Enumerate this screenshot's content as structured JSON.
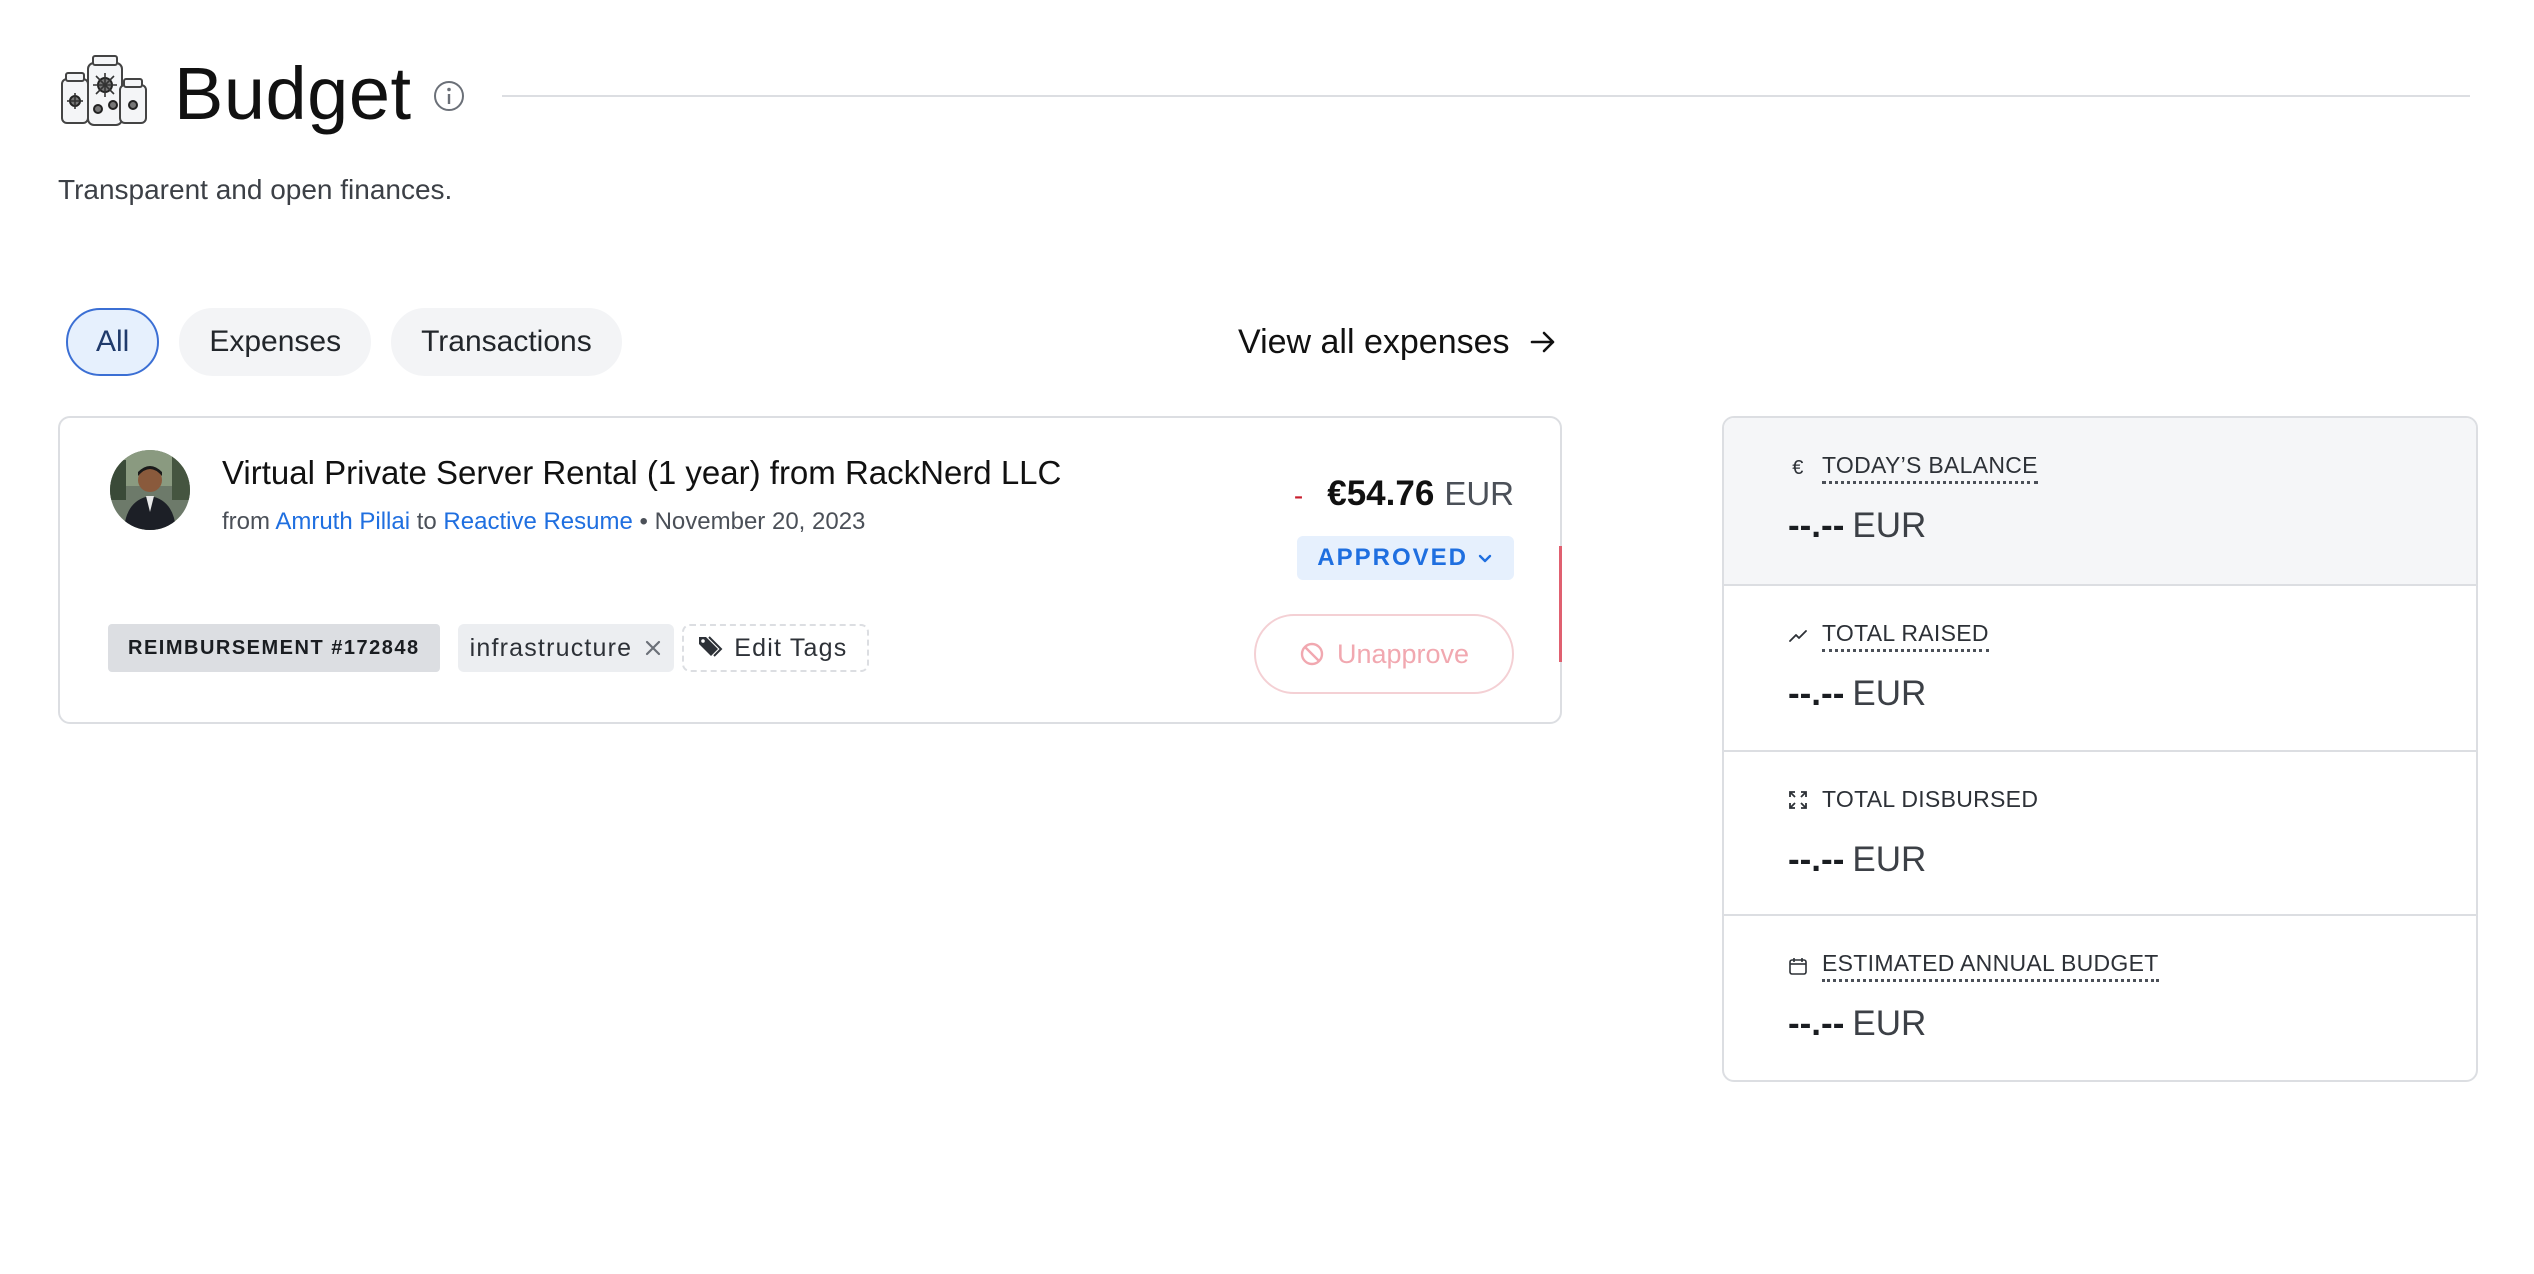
{
  "header": {
    "title": "Budget",
    "subtitle": "Transparent and open finances.",
    "logo_icon": "donation-jars-icon",
    "info_icon": "info-icon"
  },
  "tabs": [
    {
      "label": "All",
      "active": true
    },
    {
      "label": "Expenses",
      "active": false
    },
    {
      "label": "Transactions",
      "active": false
    }
  ],
  "view_all": {
    "label": "View all expenses",
    "icon": "arrow-right-icon"
  },
  "expense": {
    "title": "Virtual Private Server Rental (1 year) from RackNerd LLC",
    "from_prefix": "from",
    "from_name": "Amruth Pillai",
    "to_prefix": "to",
    "to_name": "Reactive Resume",
    "separator": "•",
    "date": "November 20, 2023",
    "amount_sign": "-",
    "amount": "€54.76",
    "currency": "EUR",
    "status": "APPROVED",
    "unapprove_label": "Unapprove",
    "reimbursement": "REIMBURSEMENT #172848",
    "tags": [
      "infrastructure"
    ],
    "edit_tags_label": "Edit Tags",
    "colors": {
      "link": "#1f6fe0",
      "negative": "#c81e2e",
      "status_bg": "#e6f0fd"
    }
  },
  "stats": [
    {
      "label": "TODAY’S BALANCE",
      "icon": "euro-icon",
      "value": "--.--",
      "currency": "EUR"
    },
    {
      "label": "TOTAL RAISED",
      "icon": "trend-up-icon",
      "value": "--.--",
      "currency": "EUR"
    },
    {
      "label": "TOTAL DISBURSED",
      "icon": "expand-icon",
      "value": "--.--",
      "currency": "EUR"
    },
    {
      "label": "ESTIMATED ANNUAL BUDGET",
      "icon": "calendar-icon",
      "value": "--.--",
      "currency": "EUR"
    }
  ]
}
